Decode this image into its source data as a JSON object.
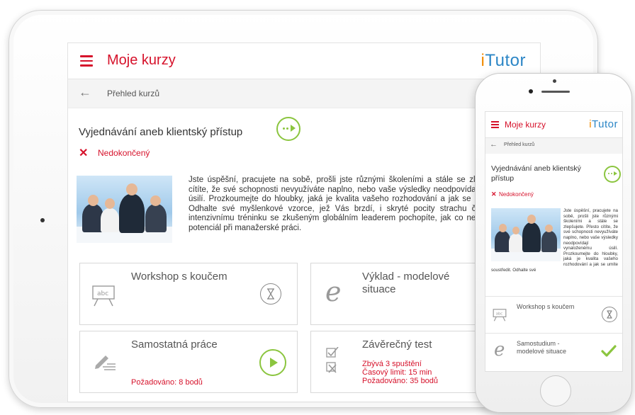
{
  "app": {
    "title": "Moje kurzy",
    "logo_i": "i",
    "logo_rest": "Tutor",
    "breadcrumb": "Přehled kurzů"
  },
  "course": {
    "title": "Vyjednávání aneb klientský přístup",
    "status": "Nedokončený",
    "description": "Jste úspěšní, pracujete na sobě, prošli jste různými školeními a stále se zlepšujete. Přesto cítíte, že své schopnosti nevyužíváte naplno, nebo vaše výsledky neodpovídají vynaloženému úsilí. Prozkoumejte do hloubky, jaká je kvalita vašeho rozhodování a jak se umíte soustředit. Odhalte své myšlenkové vzorce, jež Vás brzdí, i skryté pocity strachu či nejistoty. Díky intenzivnímu tréninku se zkušeným globálním leaderem pochopíte, jak co nejlépe využít svůj potenciál při manažerské práci."
  },
  "phone": {
    "course_title": "Vyjednávání aneb klientský přístup",
    "description": "Jste úspěšní, pracujete na sobě, prošli jste různými školeními a stále se zlepšujete. Přesto cítíte, že své schopnosti nevyužíváte naplno, nebo vaše výsledky neodpovídají vynaloženému úsilí. Prozkoumejte do hloubky, jaká je kvalita vašeho rozhodování a jak se umíte soustředit. Odhalte své",
    "row1_title": "Workshop s koučem",
    "row2_title": "Samostudium - modelové situace"
  },
  "cards": {
    "workshop": {
      "title": "Workshop s koučem",
      "icon": "board-abc-icon",
      "action_icon": "hourglass-icon"
    },
    "vyklad": {
      "title": "Výklad - modelové situace",
      "icon": "script-e-icon"
    },
    "samostatna": {
      "title": "Samostatná práce",
      "requirement": "Požadováno: 8 bodů",
      "icon": "pencil-notes-icon",
      "action_icon": "play-icon"
    },
    "test": {
      "title": "Závěrečný test",
      "line1": "Zbývá 3 spuštění",
      "line2": "Časový limit: 15 min",
      "line3": "Požadováno: 35 bodů",
      "icon": "checklist-icon"
    }
  },
  "colors": {
    "brand_red": "#d6122b",
    "accent_green": "#8bc53f",
    "logo_orange": "#f18a00",
    "logo_blue": "#2c86c6"
  }
}
